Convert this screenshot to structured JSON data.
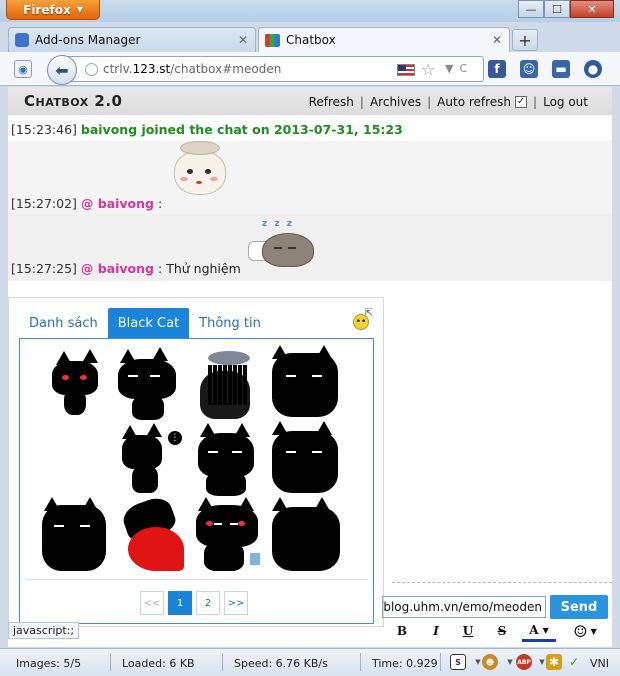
{
  "browser": {
    "menu_label": "Firefox",
    "window_controls": {
      "minimize": "—",
      "maximize": "☐",
      "close": "✕"
    },
    "tabs": [
      {
        "label": "Add-ons Manager",
        "icon": "puzzle-icon",
        "active": false
      },
      {
        "label": "Chatbox",
        "icon": "books-icon",
        "active": true
      }
    ],
    "new_tab": "+",
    "url": {
      "prefix": "ctrlv.",
      "domain": "123.st",
      "path": "/chatbox#meoden"
    },
    "toolbar_icons": [
      "facebook-icon",
      "people-icon",
      "chat-icon",
      "globe-icon"
    ]
  },
  "chatbox": {
    "title": "Chatbox 2.0",
    "links": {
      "refresh": "Refresh",
      "archives": "Archives",
      "auto_refresh": "Auto refresh",
      "logout": "Log out",
      "separator": "|"
    },
    "auto_refresh_checked": true,
    "messages": [
      {
        "time": "[15:23:46]",
        "text": "baivong joined the chat on 2013-07-31, 15:23",
        "type": "system"
      },
      {
        "time": "[15:27:02]",
        "nick": "@ baivong",
        "colon": ":",
        "text": "",
        "sticker": "cat-sticker"
      },
      {
        "time": "[15:27:25]",
        "nick": "@ baivong",
        "colon": ":",
        "text": "Thử nghiệm",
        "sticker": "sleeping-cat-sticker"
      }
    ],
    "sticker_panel": {
      "tabs": [
        {
          "label": "Danh sách",
          "active": false
        },
        {
          "label": "Black Cat",
          "active": true
        },
        {
          "label": "Thông tin",
          "active": false
        }
      ],
      "pager": [
        "<<",
        "1",
        "2",
        ">>"
      ],
      "current_page": "1"
    },
    "input_value": "http://blog.uhm.vn/emo/meoden/",
    "send_label": "Send",
    "format_buttons": {
      "bold": "B",
      "italic": "I",
      "underline": "U",
      "strike": "S",
      "color": "A",
      "emoji": "☺"
    }
  },
  "status_tip": "javascript:;",
  "statusbar": {
    "images": "Images: 5/5",
    "loaded": "Loaded: 6 KB",
    "speed": "Speed: 6.76 KB/s",
    "time": "Time: 0.929",
    "ime": "VNI"
  },
  "colors": {
    "accent": "#1a84d8",
    "nick": "#d8359a",
    "system": "#1e8e1e",
    "firefox": "#e0650a"
  }
}
